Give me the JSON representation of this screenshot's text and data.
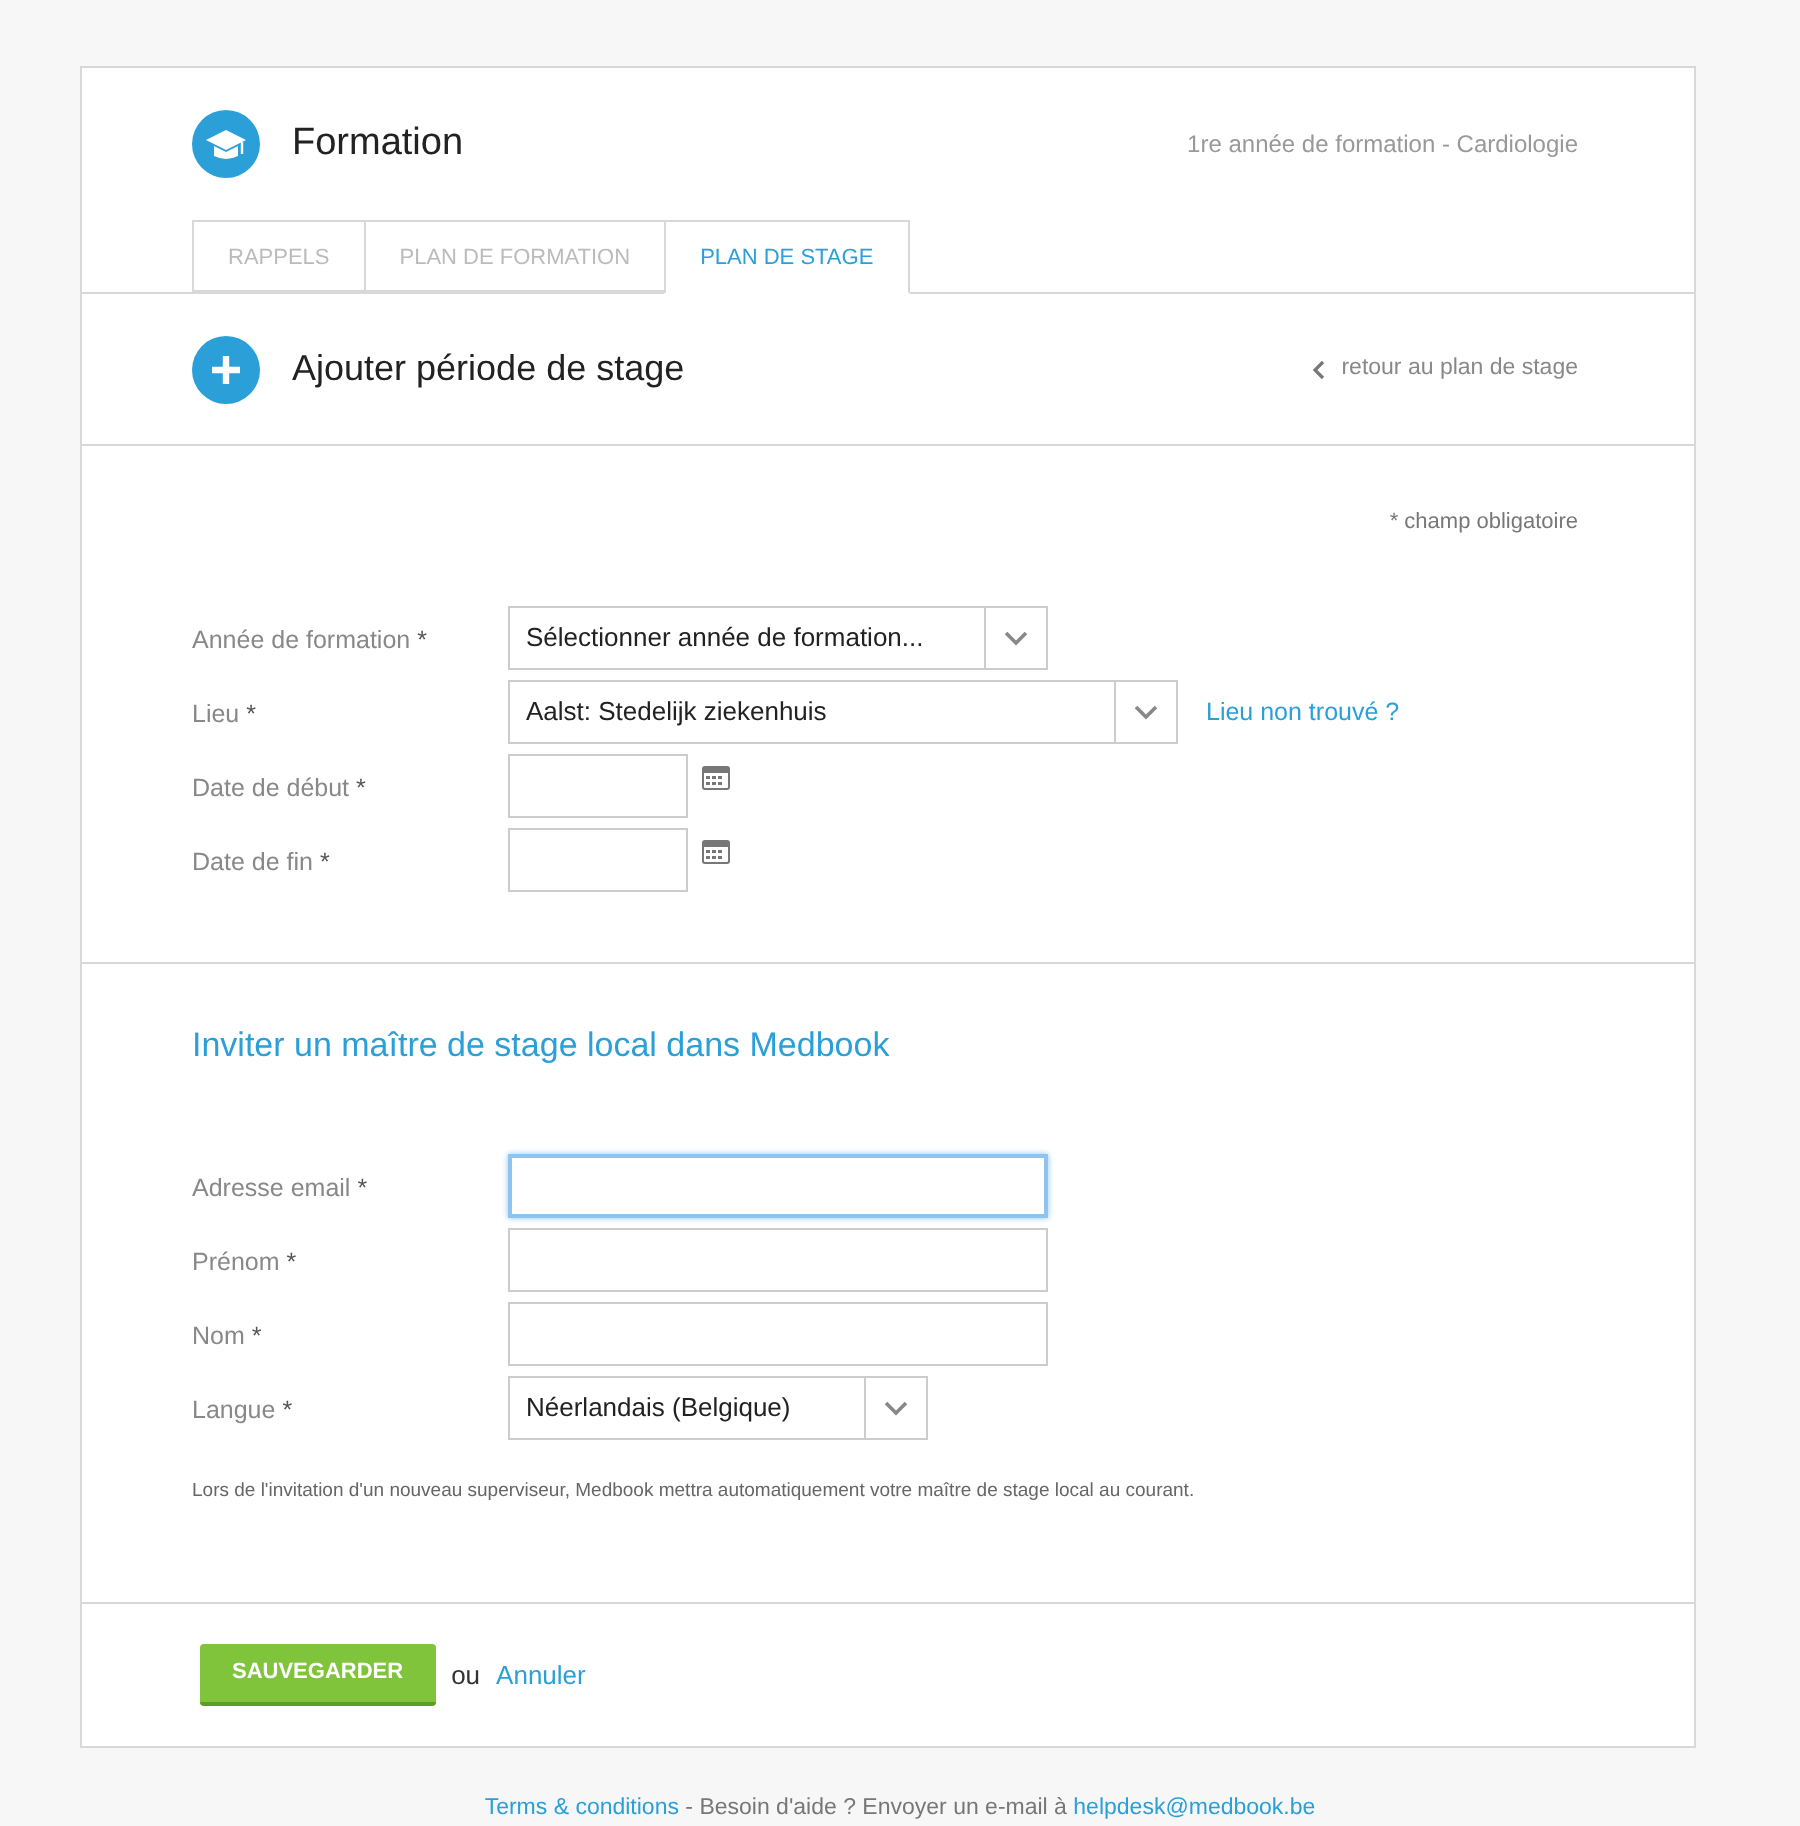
{
  "header": {
    "title": "Formation",
    "subtitle": "1re année de formation - Cardiologie"
  },
  "tabs": [
    {
      "label": "RAPPELS",
      "selected": false
    },
    {
      "label": "PLAN DE FORMATION",
      "selected": false
    },
    {
      "label": "PLAN DE STAGE",
      "selected": true
    }
  ],
  "page_heading": {
    "title": "Ajouter période de stage",
    "back_link": "retour au plan de stage"
  },
  "required_note": "* champ obligatoire",
  "period_fields": [
    {
      "kind": "select",
      "label": "Année de formation",
      "required_mark": "*",
      "value": "Sélectionner année de formation..."
    },
    {
      "kind": "select",
      "label": "Lieu",
      "required_mark": "*",
      "value": "Aalst: Stedelijk ziekenhuis",
      "link": "Lieu non trouvé ?"
    },
    {
      "kind": "date",
      "label": "Date de début",
      "required_mark": "*"
    },
    {
      "kind": "date",
      "label": "Date de fin",
      "required_mark": "*"
    }
  ],
  "invite": {
    "title": "Inviter un maître de stage local dans Medbook",
    "fields": [
      {
        "kind": "text",
        "label": "Adresse email",
        "required_mark": "*",
        "focused": true
      },
      {
        "kind": "text",
        "label": "Prénom",
        "required_mark": "*",
        "focused": false
      },
      {
        "kind": "text",
        "label": "Nom",
        "required_mark": "*",
        "focused": false
      },
      {
        "kind": "select",
        "label": "Langue",
        "required_mark": "*",
        "value": "Néerlandais (Belgique)"
      }
    ],
    "note": "Lors de l'invitation d'un nouveau superviseur, Medbook mettra automatiquement votre maître de stage local au courant."
  },
  "actions": {
    "save": "SAUVEGARDER",
    "or": "ou",
    "cancel": "Annuler"
  },
  "footer": {
    "terms": "Terms & conditions",
    "help": " - Besoin d'aide ? Envoyer un e-mail à ",
    "email": "helpdesk@medbook.be"
  }
}
